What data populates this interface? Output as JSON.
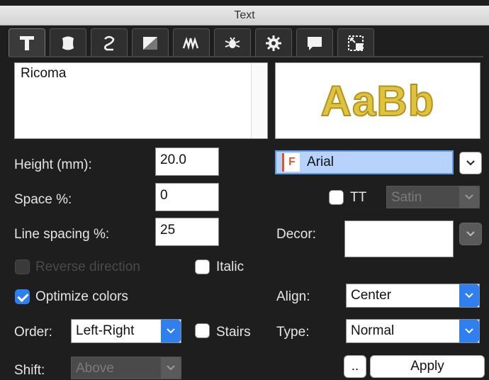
{
  "window": {
    "title": "Text"
  },
  "tabs": [
    {
      "icon": "text-icon",
      "active": true
    },
    {
      "icon": "shape-icon",
      "active": false
    },
    {
      "icon": "path-icon",
      "active": false
    },
    {
      "icon": "fill-icon",
      "active": false
    },
    {
      "icon": "stitch-icon",
      "active": false
    },
    {
      "icon": "bug-icon",
      "active": false
    },
    {
      "icon": "gear-icon",
      "active": false
    },
    {
      "icon": "comment-icon",
      "active": false
    },
    {
      "icon": "resize-icon",
      "active": false
    }
  ],
  "text_input": {
    "value": "Ricoma"
  },
  "preview": {
    "sample": "AaBb",
    "color": "#e0c33d"
  },
  "height": {
    "label": "Height (mm):",
    "value": "20.0"
  },
  "space": {
    "label": "Space %:",
    "value": "0"
  },
  "line_spacing": {
    "label": "Line spacing %:",
    "value": "25"
  },
  "reverse_direction": {
    "label": "Reverse direction",
    "checked": false,
    "enabled": false
  },
  "italic": {
    "label": "Italic",
    "checked": false
  },
  "optimize_colors": {
    "label": "Optimize colors",
    "checked": true
  },
  "order": {
    "label": "Order:",
    "value": "Left-Right"
  },
  "stairs": {
    "label": "Stairs",
    "checked": false
  },
  "shift": {
    "label": "Shift:",
    "value": "Above",
    "enabled": false
  },
  "font": {
    "icon_letter": "F",
    "value": "Arial"
  },
  "tt": {
    "label": "TT",
    "checked": false
  },
  "satin": {
    "value": "Satin",
    "enabled": false
  },
  "decor": {
    "label": "Decor:"
  },
  "align": {
    "label": "Align:",
    "value": "Center"
  },
  "type": {
    "label": "Type:",
    "value": "Normal"
  },
  "buttons": {
    "more": "..",
    "apply": "Apply"
  },
  "colors": {
    "accent": "#2f7ff1",
    "background": "#1e1e1e"
  }
}
